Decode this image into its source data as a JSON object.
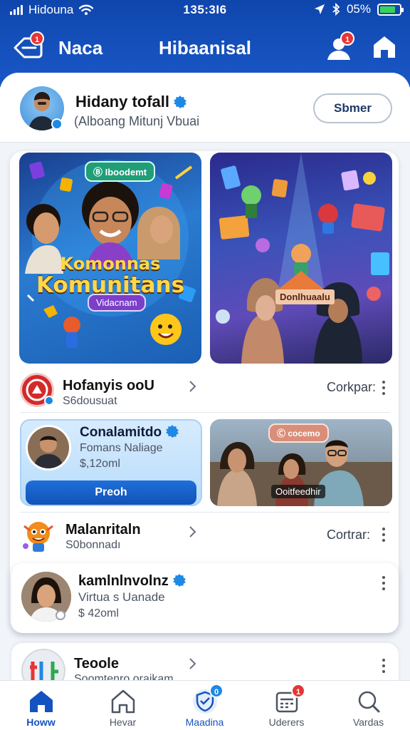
{
  "status_bar": {
    "carrier": "Hidouna",
    "time": "135:3I6",
    "battery": "05%"
  },
  "header": {
    "back_label": "Naca",
    "title": "Hibaanisal",
    "back_badge": "1",
    "user_badge": "1"
  },
  "profile": {
    "name": "Hidany tofall",
    "subtitle": "(Alboang Mitunj Vbuai",
    "button": "Sbmer"
  },
  "featured": {
    "left": {
      "tag": "Ⓑ Iboodemt",
      "headline1": "Komonnas",
      "headline2": "Komunitans",
      "pill": "Vidacnam"
    },
    "right": {
      "sign": "Donlhuaalu"
    }
  },
  "list": {
    "row1": {
      "title": "Hofanyis ooU",
      "sub": "S6dousuat",
      "meta": "Corkpar:"
    },
    "promo": {
      "title": "Conalamitdo",
      "sub": "Fomans Naliage",
      "price": "$,12oml",
      "button": "Preoh"
    },
    "photo": {
      "tag": "Ⓒ cocemo",
      "caption": "Ooitfeedhir"
    },
    "row2": {
      "title": "Malanritaln",
      "sub": "S0bonnadı",
      "meta": "Cortrar:"
    },
    "row3": {
      "title": "kamlnlnvolnz",
      "sub": "Virtua s Uanade",
      "price": "$ 42oml"
    },
    "row4": {
      "title": "Teoole",
      "sub": "Soomtenro oraikam"
    }
  },
  "tabs": [
    {
      "label": "Howw",
      "active": true
    },
    {
      "label": "Hevar"
    },
    {
      "label": "Maadina",
      "badge": "0"
    },
    {
      "label": "Uderers",
      "badge": "1"
    },
    {
      "label": "Vardas"
    }
  ],
  "colors": {
    "header": "#1550be",
    "accent": "#1552c1",
    "badge": "#e53535",
    "verified": "#1e88e5"
  }
}
